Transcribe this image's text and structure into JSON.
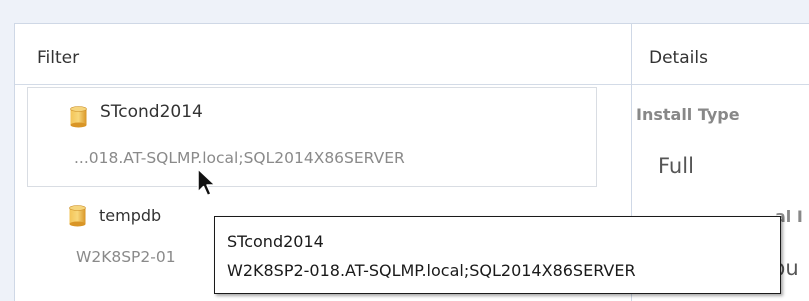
{
  "filter_pane": {
    "title": "Filter",
    "items": [
      {
        "name": "STcond2014",
        "server": "...018.AT-SQLMP.local;SQL2014X86SERVER",
        "icon": "database-icon"
      },
      {
        "name": "tempdb",
        "server": "W2K8SP2-01",
        "icon": "database-icon"
      }
    ]
  },
  "details_pane": {
    "title": "Details",
    "install_type_label": "Install Type",
    "install_type_value": "Full",
    "partial_label": "al I",
    "partial_value": "pu"
  },
  "tooltip": {
    "title": "STcond2014",
    "text": "W2K8SP2-018.AT-SQLMP.local;SQL2014X86SERVER"
  },
  "colors": {
    "background": "#eef2f9",
    "db_icon": "#e8a93a",
    "muted_text": "#8a8a8a"
  }
}
